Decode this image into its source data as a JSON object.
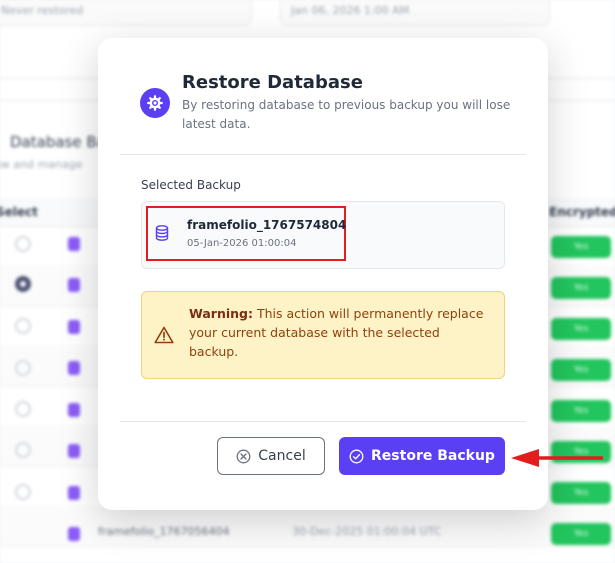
{
  "background": {
    "restored_value": "Never restored",
    "date_value": "Jan 06, 2026 1:00 AM",
    "section_title": "Database Ba",
    "section_subtitle": "ew and manage",
    "columns": {
      "select": "Select",
      "encrypted": "Encrypted"
    },
    "badge_label": "Yes",
    "last_row_name": "framefolio_1767056404",
    "last_row_date": "30-Dec-2025 01:00:04 UTC"
  },
  "modal": {
    "title": "Restore Database",
    "description": "By restoring database to previous backup you will lose latest data.",
    "selected_label": "Selected Backup",
    "backup": {
      "name": "framefolio_1767574804",
      "date": "05-Jan-2026 01:00:04"
    },
    "warning": {
      "strong": "Warning:",
      "text": " This action will permanently replace your current database with the selected backup."
    },
    "buttons": {
      "cancel": "Cancel",
      "restore": "Restore Backup"
    }
  },
  "colors": {
    "accent": "#5b3ff5",
    "warning_bg": "#fef3c7",
    "warning_text": "#92400e",
    "highlight": "#e11d1d",
    "success": "#22c55e"
  },
  "icons": {
    "header": "gear-icon",
    "backup": "database-icon",
    "warning": "warning-triangle-icon",
    "cancel": "x-circle-icon",
    "restore": "check-circle-icon"
  }
}
